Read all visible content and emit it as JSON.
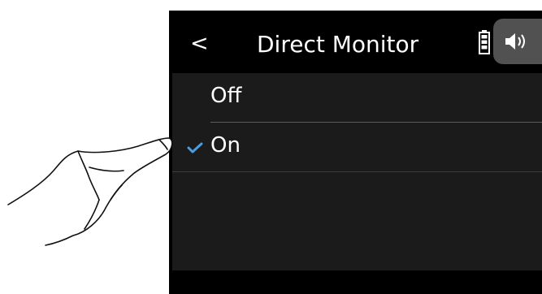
{
  "screen": {
    "title": "Direct Monitor",
    "back_glyph": "<",
    "icons": {
      "back": "chevron-left-icon",
      "battery": "battery-icon",
      "speaker": "speaker-icon",
      "check": "check-icon",
      "finger": "pointing-hand-icon"
    },
    "options": [
      {
        "label": "Off",
        "selected": false
      },
      {
        "label": "On",
        "selected": true
      }
    ]
  },
  "colors": {
    "screen_background": "#1b1b1b",
    "title_bar": "#000000",
    "text": "#ffffff",
    "check": "#4a9de0",
    "speaker_button": "#515151"
  }
}
